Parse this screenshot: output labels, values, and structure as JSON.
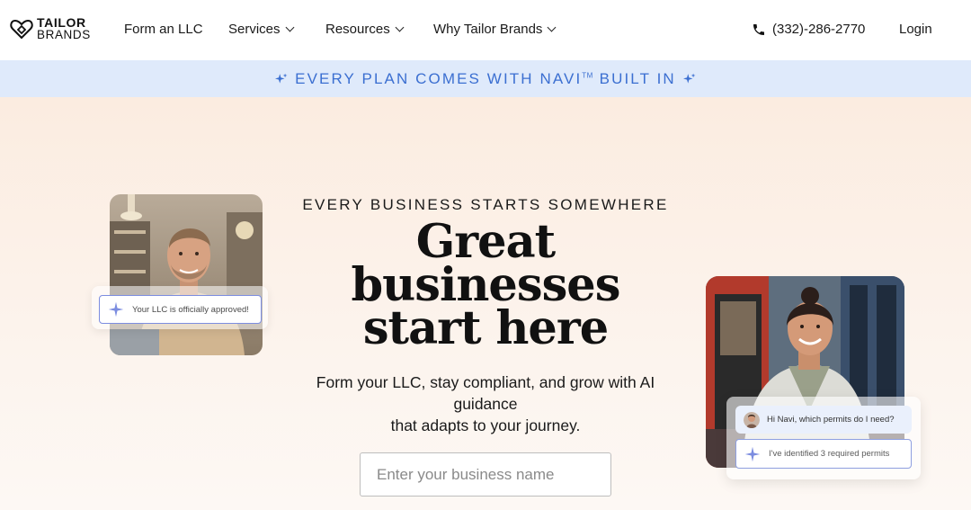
{
  "header": {
    "logo_line1": "TAILOR",
    "logo_line2": "BRANDS",
    "nav": [
      {
        "label": "Form an LLC",
        "dropdown": false
      },
      {
        "label": "Services",
        "dropdown": true
      },
      {
        "label": "Resources",
        "dropdown": true
      },
      {
        "label": "Why Tailor Brands",
        "dropdown": true
      }
    ],
    "phone": "(332)-286-2770",
    "login": "Login"
  },
  "banner": {
    "text": "EVERY PLAN COMES WITH NAVI",
    "trademark": "TM",
    "text_suffix": " BUILT IN",
    "icon": "sparkle-icon",
    "color": "#3b6fd1",
    "background": "#dfeafb"
  },
  "hero": {
    "eyebrow": "EVERY BUSINESS STARTS SOMEWHERE",
    "headline_line1": "Great",
    "headline_line2": "businesses",
    "headline_line3": "start here",
    "subtext_line1": "Form your LLC, stay compliant, and grow with AI guidance",
    "subtext_line2": "that adapts to your journey.",
    "input_placeholder": "Enter your business name",
    "input_value": ""
  },
  "cards": {
    "approved_message": "Your LLC is officially approved!",
    "chat_question": "Hi Navi, which permits do I need?",
    "chat_answer": "I've identified 3 required permits"
  },
  "colors": {
    "accent_blue": "#3b6fd1",
    "sparkle_purple": "#7c8de0",
    "hero_bg_top": "#fbece0"
  }
}
